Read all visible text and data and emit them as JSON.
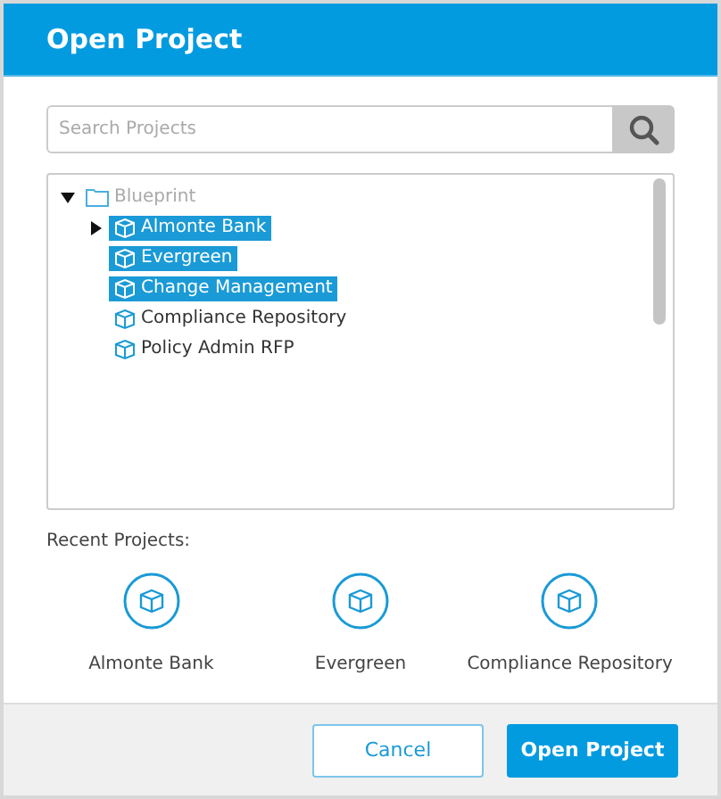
{
  "dialog": {
    "title": "Open Project"
  },
  "search": {
    "placeholder": "Search Projects"
  },
  "tree": [
    {
      "kind": "folder",
      "label": "Blueprint",
      "expanded": true,
      "selected": false,
      "children": [
        {
          "kind": "project",
          "label": "Almonte Bank",
          "expanded": false,
          "selected": true
        },
        {
          "kind": "project",
          "label": "Evergreen",
          "selected": true
        },
        {
          "kind": "project",
          "label": "Change Management",
          "selected": true
        },
        {
          "kind": "project",
          "label": "Compliance Repository",
          "selected": false
        },
        {
          "kind": "project",
          "label": "Policy Admin RFP",
          "selected": false
        }
      ]
    }
  ],
  "recent": {
    "label": "Recent Projects:",
    "items": [
      "Almonte Bank",
      "Evergreen",
      "Compliance Repository"
    ]
  },
  "buttons": [
    {
      "kind": "secondary",
      "label": "Cancel"
    },
    {
      "kind": "primary",
      "label": "Open Project"
    }
  ]
}
